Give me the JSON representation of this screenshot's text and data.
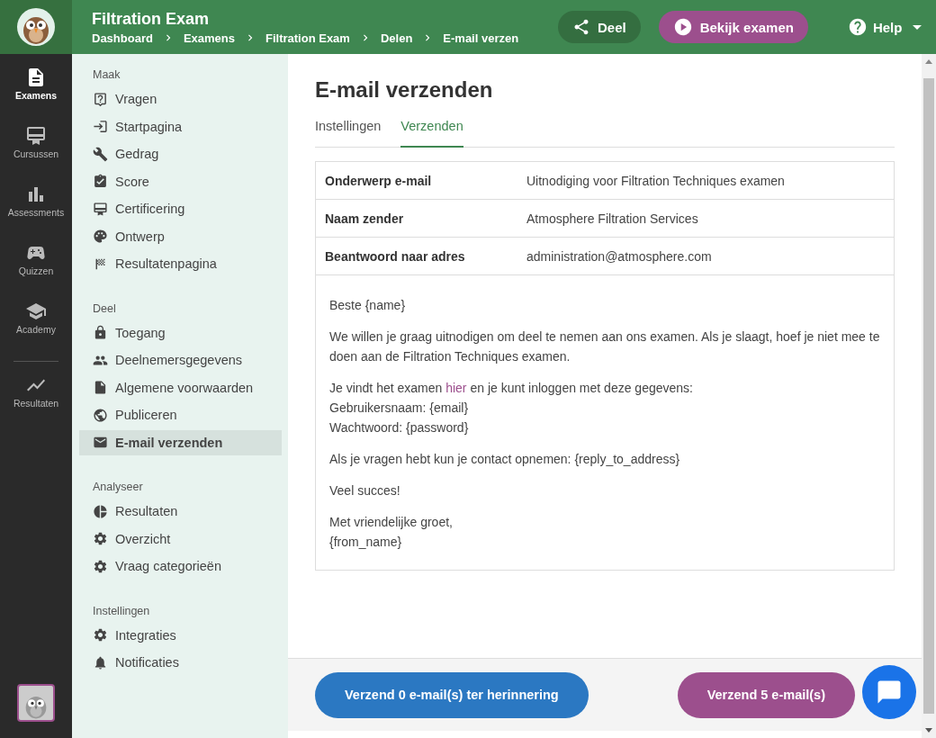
{
  "header": {
    "title": "Filtration Exam",
    "breadcrumbs": [
      "Dashboard",
      "Examens",
      "Filtration Exam",
      "Delen",
      "E-mail verzen"
    ],
    "share_button": "Deel",
    "view_button": "Bekijk examen",
    "help": "Help"
  },
  "rail": [
    {
      "label": "Examens",
      "selected": true
    },
    {
      "label": "Cursussen",
      "selected": false
    },
    {
      "label": "Assessments",
      "selected": false
    },
    {
      "label": "Quizzen",
      "selected": false
    },
    {
      "label": "Academy",
      "selected": false
    },
    {
      "label": "Resultaten",
      "selected": false
    }
  ],
  "sidebar": [
    {
      "heading": "Maak",
      "items": [
        {
          "label": "Vragen",
          "selected": false
        },
        {
          "label": "Startpagina",
          "selected": false
        },
        {
          "label": "Gedrag",
          "selected": false
        },
        {
          "label": "Score",
          "selected": false
        },
        {
          "label": "Certificering",
          "selected": false
        },
        {
          "label": "Ontwerp",
          "selected": false
        },
        {
          "label": "Resultatenpagina",
          "selected": false
        }
      ]
    },
    {
      "heading": "Deel",
      "items": [
        {
          "label": "Toegang",
          "selected": false
        },
        {
          "label": "Deelnemersgegevens",
          "selected": false
        },
        {
          "label": "Algemene voorwaarden",
          "selected": false
        },
        {
          "label": "Publiceren",
          "selected": false
        },
        {
          "label": "E-mail verzenden",
          "selected": true
        }
      ]
    },
    {
      "heading": "Analyseer",
      "items": [
        {
          "label": "Resultaten",
          "selected": false
        },
        {
          "label": "Overzicht",
          "selected": false
        },
        {
          "label": "Vraag categorieën",
          "selected": false
        }
      ]
    },
    {
      "heading": "Instellingen",
      "items": [
        {
          "label": "Integraties",
          "selected": false
        },
        {
          "label": "Notificaties",
          "selected": false
        }
      ]
    }
  ],
  "page_title": "E-mail verzenden",
  "tabs": [
    {
      "label": "Instellingen",
      "selected": false
    },
    {
      "label": "Verzenden",
      "selected": true
    }
  ],
  "email_fields": [
    {
      "label": "Onderwerp e-mail",
      "value": "Uitnodiging voor Filtration Techniques examen"
    },
    {
      "label": "Naam zender",
      "value": "Atmosphere Filtration Services"
    },
    {
      "label": "Beantwoord naar adres",
      "value": "administration@atmosphere.com"
    }
  ],
  "email_body": [
    {
      "kind": "text",
      "lines": [
        "Beste {name}"
      ]
    },
    {
      "kind": "text",
      "lines": [
        "We willen je graag uitnodigen om deel te nemen aan ons examen. Als je slaagt, hoef je niet mee te doen aan de Filtration Techniques examen."
      ]
    },
    {
      "kind": "link",
      "before": "Je vindt het examen",
      "link": "hier",
      "after": "en je kunt inloggen met deze gegevens:",
      "lines": [
        "Gebruikersnaam: {email}",
        "Wachtwoord: {password}"
      ]
    },
    {
      "kind": "text",
      "lines": [
        "Als je vragen hebt kun je contact opnemen: {reply_to_address}"
      ]
    },
    {
      "kind": "text",
      "lines": [
        "Veel succes!"
      ]
    },
    {
      "kind": "text",
      "lines": [
        "Met vriendelijke groet,",
        "{from_name}"
      ]
    }
  ],
  "footer_buttons": [
    {
      "label": "Verzend 0 e-mail(s) ter herinnering",
      "color": "#2b78c2"
    },
    {
      "label": "Verzend 5 e-mail(s)",
      "color": "#9c4f8d"
    }
  ]
}
